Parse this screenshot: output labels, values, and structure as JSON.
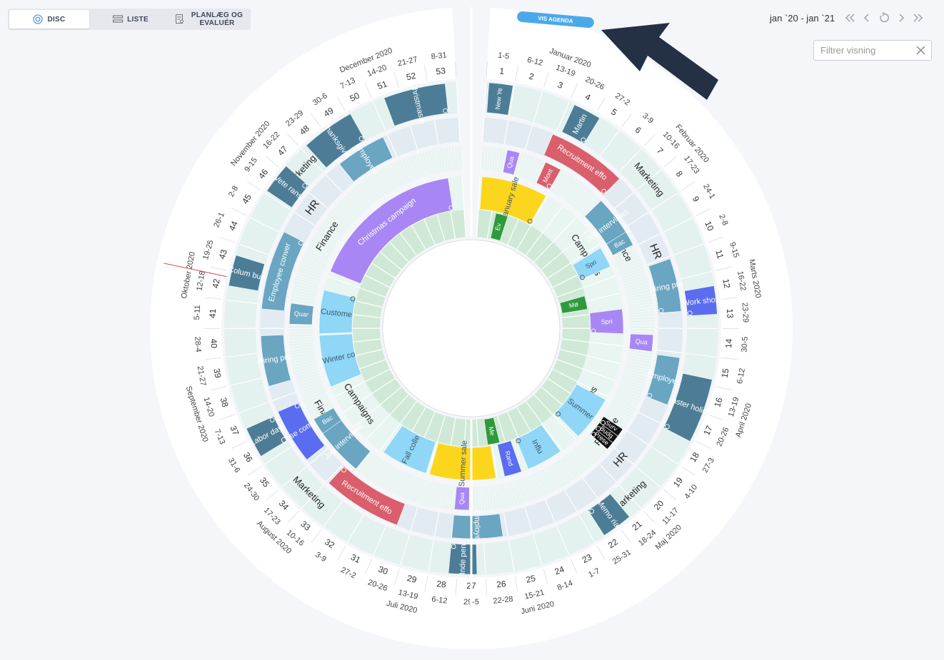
{
  "view_tabs": {
    "disc": "DISC",
    "liste": "LISTE",
    "planlaeg": "PLANLÆG OG EVALUÉR"
  },
  "date_range": "jan `20 - jan `21",
  "filter": {
    "placeholder": "Filtrer visning",
    "value": ""
  },
  "agenda_button": "VIS AGENDA",
  "icons": {
    "disc": "disc-icon",
    "list": "list-icon",
    "plan": "plan-icon",
    "first": "double-chevron-left-icon",
    "prev": "chevron-left-icon",
    "reset": "reset-icon",
    "next": "chevron-right-icon",
    "last": "double-chevron-right-icon",
    "clear": "close-icon",
    "repeat": "repeat-icon"
  },
  "colors": {
    "accent": "#4e9fe6",
    "arrow": "#243044",
    "dark_teal": "#4d7d96",
    "mid_teal": "#6aa5c2",
    "red": "#d95f6c",
    "purple": "#a887f5",
    "yellow": "#fcd61c",
    "light_blue": "#8fd6f7",
    "indigo": "#5a6cf0",
    "green": "#2e9a3d",
    "black": "#111111"
  },
  "months": [
    {
      "label": "Januar 2020",
      "pos": 2.5
    },
    {
      "label": "Februar 2020",
      "pos": 7
    },
    {
      "label": "Marts 2020",
      "pos": 11.5
    },
    {
      "label": "April 2020",
      "pos": 15.8
    },
    {
      "label": "Maj 2020",
      "pos": 20
    },
    {
      "label": "Juni 2020",
      "pos": 24.5
    },
    {
      "label": "Juli 2020",
      "pos": 28.6
    },
    {
      "label": "August 2020",
      "pos": 33
    },
    {
      "label": "September 2020",
      "pos": 37.4
    },
    {
      "label": "Oktober 2020",
      "pos": 41.6
    },
    {
      "label": "November 2020",
      "pos": 46
    },
    {
      "label": "December 2020",
      "pos": 50.3
    }
  ],
  "weeks": [
    {
      "n": "1",
      "d": "1-5"
    },
    {
      "n": "2",
      "d": "6-12"
    },
    {
      "n": "3",
      "d": "13-19"
    },
    {
      "n": "4",
      "d": "20-26"
    },
    {
      "n": "5",
      "d": "27-2"
    },
    {
      "n": "6",
      "d": "3-9"
    },
    {
      "n": "7",
      "d": "10-16"
    },
    {
      "n": "8",
      "d": "17-23"
    },
    {
      "n": "9",
      "d": "24-1"
    },
    {
      "n": "10",
      "d": "2-8"
    },
    {
      "n": "11",
      "d": "9-15"
    },
    {
      "n": "12",
      "d": "16-22"
    },
    {
      "n": "13",
      "d": "23-29"
    },
    {
      "n": "14",
      "d": "30-5"
    },
    {
      "n": "15",
      "d": "6-12"
    },
    {
      "n": "16",
      "d": "13-19"
    },
    {
      "n": "17",
      "d": "20-26"
    },
    {
      "n": "18",
      "d": "27-3"
    },
    {
      "n": "19",
      "d": "4-10"
    },
    {
      "n": "20",
      "d": "11-17"
    },
    {
      "n": "21",
      "d": "18-24"
    },
    {
      "n": "22",
      "d": "25-31"
    },
    {
      "n": "23",
      "d": "1-7"
    },
    {
      "n": "24",
      "d": "8-14"
    },
    {
      "n": "25",
      "d": "15-21"
    },
    {
      "n": "26",
      "d": "22-28"
    },
    {
      "n": "27",
      "d": "29-5"
    },
    {
      "n": "28",
      "d": "6-12"
    },
    {
      "n": "29",
      "d": "13-19"
    },
    {
      "n": "30",
      "d": "20-26"
    },
    {
      "n": "31",
      "d": "27-2"
    },
    {
      "n": "32",
      "d": "3-9"
    },
    {
      "n": "33",
      "d": "10-16"
    },
    {
      "n": "34",
      "d": "17-23"
    },
    {
      "n": "35",
      "d": "24-30"
    },
    {
      "n": "36",
      "d": "31-6"
    },
    {
      "n": "37",
      "d": "7-13"
    },
    {
      "n": "38",
      "d": "14-20"
    },
    {
      "n": "39",
      "d": "21-27"
    },
    {
      "n": "40",
      "d": "28-4"
    },
    {
      "n": "41",
      "d": "5-11"
    },
    {
      "n": "42",
      "d": "12-18"
    },
    {
      "n": "43",
      "d": "19-25"
    },
    {
      "n": "44",
      "d": "26-1"
    },
    {
      "n": "45",
      "d": "2-8"
    },
    {
      "n": "46",
      "d": "9-15"
    },
    {
      "n": "47",
      "d": "16-22"
    },
    {
      "n": "48",
      "d": "23-29"
    },
    {
      "n": "49",
      "d": "30-6"
    },
    {
      "n": "50",
      "d": "7-13"
    },
    {
      "n": "51",
      "d": "14-20"
    },
    {
      "n": "52",
      "d": "21-27"
    },
    {
      "n": "53",
      "d": "8-31"
    }
  ],
  "ring_labels": [
    {
      "text": "Marketing",
      "ring": "marketing",
      "pos": 7
    },
    {
      "text": "Marketing",
      "ring": "marketing",
      "pos": 20
    },
    {
      "text": "Marketing",
      "ring": "marketing",
      "pos": 33.2
    },
    {
      "text": "Marketing",
      "ring": "marketing",
      "pos": 46.4
    },
    {
      "text": "HR",
      "ring": "hr",
      "pos": 9.6
    },
    {
      "text": "HR",
      "ring": "hr",
      "pos": 19.2
    },
    {
      "text": "HR",
      "ring": "hr",
      "pos": 35.6
    },
    {
      "text": "HR",
      "ring": "hr",
      "pos": 45.6
    },
    {
      "text": "Finance",
      "ring": "finance",
      "pos": 8.7
    },
    {
      "text": "Finance",
      "ring": "finance",
      "pos": 18.6
    },
    {
      "text": "Finance",
      "ring": "finance",
      "pos": 35.4
    },
    {
      "text": "Finance",
      "ring": "finance",
      "pos": 44.9
    },
    {
      "text": "Campaigns",
      "ring": "campaigns",
      "pos": 8.1
    },
    {
      "text": "Campaigns",
      "ring": "campaigns",
      "pos": 18.3
    },
    {
      "text": "Campaigns",
      "ring": "campaigns",
      "pos": 34.9
    },
    {
      "text": "Campaigns",
      "ring": "campaigns",
      "pos": 45.3
    }
  ],
  "events": [
    {
      "label": "New Ye",
      "ring": "marketing",
      "start": 0.1,
      "end": 0.95,
      "color": "#4d7d96",
      "repeat": false
    },
    {
      "label": "Martin",
      "ring": "marketing",
      "start": 3.2,
      "end": 4.2,
      "color": "#4d7d96",
      "repeat": true
    },
    {
      "label": "Work shop",
      "ring": "marketing",
      "start": 11.5,
      "end": 12.5,
      "color": "#5a6cf0",
      "repeat": true
    },
    {
      "label": "Easter holida",
      "ring": "marketing",
      "start": 14.8,
      "end": 17.1,
      "color": "#4d7d96",
      "repeat": true
    },
    {
      "label": "Memo rial",
      "ring": "marketing",
      "start": 20.5,
      "end": 21.6,
      "color": "#4d7d96",
      "repeat": true
    },
    {
      "label": "Inde pen",
      "ring": "marketing",
      "start": 26.3,
      "end": 27.3,
      "color": "#4d7d96",
      "repeat": true
    },
    {
      "label": "Labor day",
      "ring": "marketing",
      "start": 35.3,
      "end": 36.4,
      "color": "#4d7d96",
      "repeat": true
    },
    {
      "label": "Colum bus",
      "ring": "marketing",
      "start": 41.5,
      "end": 42.6,
      "color": "#4d7d96",
      "repeat": false
    },
    {
      "label": "Vete rans",
      "ring": "marketing",
      "start": 45.1,
      "end": 46.2,
      "color": "#4d7d96",
      "repeat": true
    },
    {
      "label": "Thanksgivin",
      "ring": "marketing",
      "start": 47.2,
      "end": 49.1,
      "color": "#4d7d96",
      "repeat": true
    },
    {
      "label": "Christmas h",
      "ring": "marketing",
      "start": 50.4,
      "end": 52.6,
      "color": "#4d7d96",
      "repeat": true
    },
    {
      "label": "Recruitment effo",
      "ring": "hr",
      "start": 2.9,
      "end": 6.2,
      "color": "#d95f6c",
      "repeat": true
    },
    {
      "label": "Hiring pro",
      "ring": "hr",
      "start": 10.1,
      "end": 12.3,
      "color": "#6aa5c2",
      "repeat": true
    },
    {
      "label": "Employee",
      "ring": "hr",
      "start": 14.2,
      "end": 16.2,
      "color": "#6aa5c2",
      "repeat": true
    },
    {
      "label": "Employee",
      "ring": "hr",
      "start": 25.2,
      "end": 27.3,
      "color": "#6aa5c2",
      "repeat": false
    },
    {
      "label": "Recruitment effo",
      "ring": "hr",
      "start": 29.6,
      "end": 32.9,
      "color": "#d95f6c",
      "repeat": true
    },
    {
      "label": "Case compe",
      "ring": "hr",
      "start": 34.2,
      "end": 36.5,
      "color": "#5a6cf0",
      "repeat": true
    },
    {
      "label": "Hiring pro",
      "ring": "hr",
      "start": 37.6,
      "end": 39.7,
      "color": "#6aa5c2",
      "repeat": false
    },
    {
      "label": "Employee conver",
      "ring": "hr",
      "start": 40.8,
      "end": 44.1,
      "color": "#6aa5c2",
      "repeat": true
    },
    {
      "label": "Employee",
      "ring": "hr",
      "start": 47.7,
      "end": 49.8,
      "color": "#6aa5c2",
      "repeat": false
    },
    {
      "label": "Qua",
      "ring": "finance",
      "start": 1.2,
      "end": 1.8,
      "color": "#a887f5",
      "repeat": false
    },
    {
      "label": "Mont",
      "ring": "finance",
      "start": 3.1,
      "end": 3.9,
      "color": "#d95f6c",
      "repeat": true
    },
    {
      "label": "Job interviews",
      "ring": "finance",
      "start": 6.3,
      "end": 8.6,
      "color": "#6aa5c2",
      "repeat": false
    },
    {
      "label": "Bac",
      "ring": "finance",
      "start": 8.2,
      "end": 8.9,
      "color": "#6aa5c2",
      "repeat": false
    },
    {
      "label": "Qua",
      "ring": "finance",
      "start": 13.3,
      "end": 14.1,
      "color": "#a887f5",
      "repeat": false
    },
    {
      "label": "Surv",
      "ring": "finance",
      "start": 18.05,
      "end": 18.45,
      "color": "#111111",
      "repeat": true
    },
    {
      "label": "Budg",
      "ring": "finance",
      "start": 18.45,
      "end": 18.85,
      "color": "#111111",
      "repeat": true
    },
    {
      "label": "Prese",
      "ring": "finance",
      "start": 18.85,
      "end": 19.25,
      "color": "#111111",
      "repeat": true
    },
    {
      "label": "Qua",
      "ring": "finance",
      "start": 26.6,
      "end": 27.3,
      "color": "#a887f5",
      "repeat": false
    },
    {
      "label": "Job interviews",
      "ring": "finance",
      "start": 32.4,
      "end": 35.1,
      "color": "#6aa5c2",
      "repeat": false
    },
    {
      "label": "Bac",
      "ring": "finance",
      "start": 34.7,
      "end": 35.5,
      "color": "#6aa5c2",
      "repeat": false
    },
    {
      "label": "Quar",
      "ring": "finance",
      "start": 40.2,
      "end": 41.2,
      "color": "#6aa5c2",
      "repeat": false
    },
    {
      "label": "January sale",
      "ring": "campaigns",
      "start": 0.1,
      "end": 3.9,
      "color": "#fcd61c",
      "repeat": true
    },
    {
      "label": "Spri",
      "ring": "campaigns",
      "start": 8.2,
      "end": 9.4,
      "color": "#8fd6f7",
      "repeat": true
    },
    {
      "label": "Spri",
      "ring": "campaigns",
      "start": 11.9,
      "end": 13.3,
      "color": "#a887f5",
      "repeat": true
    },
    {
      "label": "Summer",
      "ring": "campaigns",
      "start": 17.2,
      "end": 19.8,
      "color": "#8fd6f7",
      "repeat": true
    },
    {
      "label": "Influ",
      "ring": "campaigns",
      "start": 21.1,
      "end": 23.2,
      "color": "#8fd6f7",
      "repeat": true
    },
    {
      "label": "Rand",
      "ring": "campaigns",
      "start": 23.6,
      "end": 24.6,
      "color": "#5a6cf0",
      "repeat": false
    },
    {
      "label": "Summer sale",
      "ring": "campaigns",
      "start": 25.1,
      "end": 28.9,
      "color": "#fcd61c",
      "repeat": false
    },
    {
      "label": "Fall colle",
      "ring": "campaigns",
      "start": 29.1,
      "end": 31.8,
      "color": "#8fd6f7",
      "repeat": false
    },
    {
      "label": "Winter co",
      "ring": "campaigns",
      "start": 36.6,
      "end": 39.6,
      "color": "#8fd6f7",
      "repeat": false
    },
    {
      "label": "Custome",
      "ring": "campaigns",
      "start": 39.7,
      "end": 42.2,
      "color": "#8fd6f7",
      "repeat": true
    },
    {
      "label": "Christmas campaign",
      "ring": "campaigns",
      "start": 43.3,
      "end": 52.2,
      "color": "#a887f5",
      "repeat": true
    },
    {
      "label": "Ev",
      "ring": "inner",
      "start": 1.3,
      "end": 2.2,
      "color": "#2e9a3d",
      "repeat": false
    },
    {
      "label": "Mø",
      "ring": "inner",
      "start": 10.6,
      "end": 11.6,
      "color": "#2e9a3d",
      "repeat": false
    },
    {
      "label": "Me",
      "ring": "inner",
      "start": 24.4,
      "end": 25.3,
      "color": "#2e9a3d",
      "repeat": false
    }
  ]
}
